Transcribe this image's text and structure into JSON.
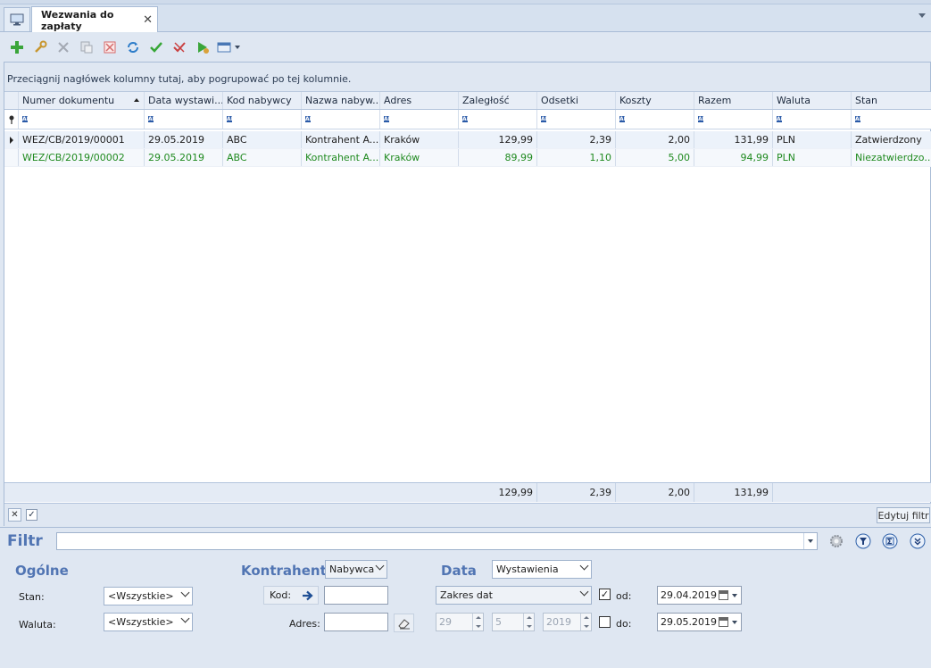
{
  "tab": {
    "title": "Wezwania do zapłaty",
    "close": "✕"
  },
  "toolbar": {
    "icons": [
      "add-icon",
      "edit-icon",
      "delete-icon",
      "copy-icon",
      "cancel-icon",
      "refresh-icon",
      "approve-icon",
      "unapprove-icon",
      "run-icon",
      "view-icon"
    ]
  },
  "group_hint": "Przeciągnij nagłówek kolumny tutaj, aby pogrupować po tej kolumnie.",
  "grid": {
    "columns": [
      "Numer dokumentu",
      "Data wystawi...",
      "Kod nabywcy",
      "Nazwa nabyw...",
      "Adres",
      "Zaległość",
      "Odsetki",
      "Koszty",
      "Razem",
      "Waluta",
      "Stan"
    ],
    "filter_glyph": "ABC",
    "rows": [
      [
        "WEZ/CB/2019/00001",
        "29.05.2019",
        "ABC",
        "Kontrahent A...",
        "Kraków",
        "129,99",
        "2,39",
        "2,00",
        "131,99",
        "PLN",
        "Zatwierdzony"
      ],
      [
        "WEZ/CB/2019/00002",
        "29.05.2019",
        "ABC",
        "Kontrahent A...",
        "Kraków",
        "89,99",
        "1,10",
        "5,00",
        "94,99",
        "PLN",
        "Niezatwierdzo..."
      ]
    ],
    "totals": {
      "zaleglosc": "129,99",
      "odsetki": "2,39",
      "koszty": "2,00",
      "razem": "131,99"
    }
  },
  "statusbar": {
    "clear": "✕",
    "check": "✓",
    "edit_filter": "Edytuj filtr"
  },
  "filter": {
    "title": "Filtr",
    "ogolne": "Ogólne",
    "stan_label": "Stan:",
    "stan_value": "<Wszystkie>",
    "waluta_label": "Waluta:",
    "waluta_value": "<Wszystkie>",
    "kontrahent": "Kontrahent",
    "kontrahent_type": "Nabywca",
    "kod_label": "Kod:",
    "adres_label": "Adres:",
    "data": "Data",
    "data_type": "Wystawienia",
    "zakres": "Zakres dat",
    "day": "29",
    "month": "5",
    "year": "2019",
    "od_label": "od:",
    "od_value": "29.04.2019",
    "do_label": "do:",
    "do_value": "29.05.2019"
  }
}
